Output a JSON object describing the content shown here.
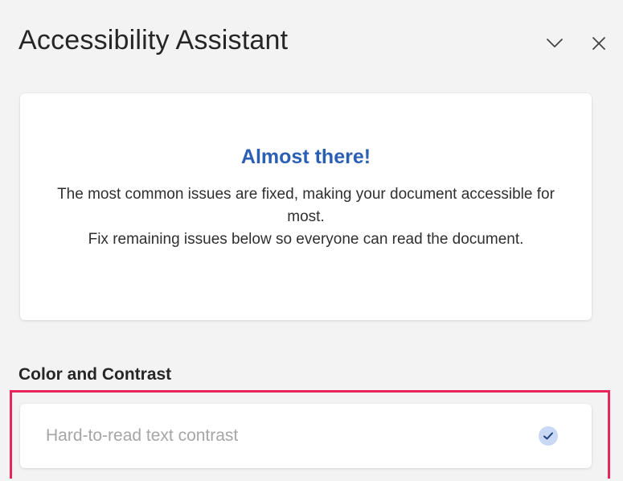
{
  "pane": {
    "title": "Accessibility Assistant",
    "collapse_icon": "chevron-down-icon",
    "close_icon": "close-icon"
  },
  "status": {
    "heading": "Almost there!",
    "lines": [
      "The most common issues are fixed, making your document accessible for most.",
      "Fix remaining issues below so everyone can read the document."
    ]
  },
  "sections": [
    {
      "heading": "Color and Contrast",
      "issues": [
        {
          "label": "Hard-to-read text contrast",
          "status_icon": "checkmark-icon",
          "resolved": true
        }
      ]
    }
  ],
  "colors": {
    "accent_blue": "#2b5fb3",
    "highlight_frame": "#e8245a",
    "check_badge": "#c9d8f4",
    "check_mark": "#1f3f7a"
  }
}
